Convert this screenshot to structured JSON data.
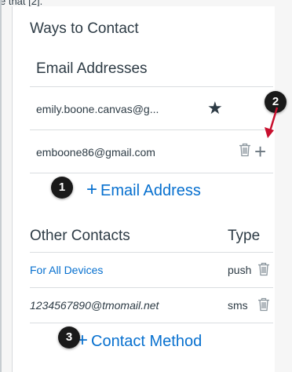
{
  "top_text": "e that [2].",
  "ways_to_contact": {
    "title": "Ways to Contact"
  },
  "email": {
    "header": "Email Addresses",
    "addresses": [
      {
        "value": "emily.boone.canvas@g...",
        "default_icon": "star-icon"
      },
      {
        "value": "emboone86@gmail.com",
        "actions": [
          "trash-icon",
          "plus-icon"
        ]
      }
    ],
    "add_label": "Email Address"
  },
  "other_contacts": {
    "header": "Other Contacts",
    "type_header": "Type",
    "rows": [
      {
        "name": "For All Devices",
        "type": "push",
        "name_color": "#0770cf"
      },
      {
        "name": "1234567890@tmomail.net",
        "type": "sms",
        "name_color": "#2d3b45"
      }
    ],
    "add_label": "Contact Method"
  },
  "annotations": {
    "badge1": "1",
    "badge2": "2",
    "badge3": "3"
  },
  "colors": {
    "link": "#0770cf",
    "arrow": "#c8102e",
    "text": "#2d3b45",
    "badge": "#1a1a1a"
  }
}
